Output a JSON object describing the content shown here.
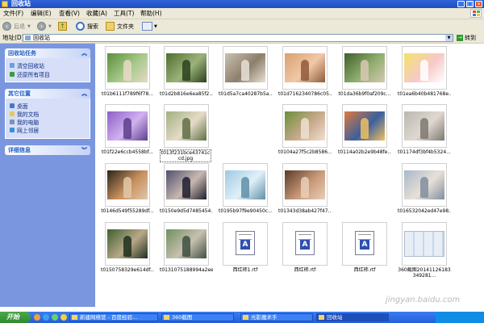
{
  "window": {
    "title": "回收站"
  },
  "menu": [
    "文件(F)",
    "编辑(E)",
    "查看(V)",
    "收藏(A)",
    "工具(T)",
    "帮助(H)"
  ],
  "toolbar": {
    "back": "后退",
    "search": "搜索",
    "folders": "文件夹"
  },
  "address": {
    "label": "地址(D)",
    "value": "回收站",
    "go": "转到"
  },
  "sidebar": {
    "tasks": {
      "title": "回收站任务",
      "items": [
        "清空回收站",
        "还原所有项目"
      ]
    },
    "places": {
      "title": "其它位置",
      "items": [
        "桌面",
        "我的文档",
        "我的电脑",
        "网上邻居"
      ]
    },
    "details": {
      "title": "详细信息"
    }
  },
  "files": [
    {
      "name": "t01b6111f789f6f78...",
      "art": "photo"
    },
    {
      "name": "t01d2b816e6ea85f2...",
      "art": "photo"
    },
    {
      "name": "t01d5a7ca40287b5a...",
      "art": "photo"
    },
    {
      "name": "t01d7162340786c05...",
      "art": "photo"
    },
    {
      "name": "t01da36b9f0af209c...",
      "art": "photo"
    },
    {
      "name": "t01ea6b40b481768e...",
      "art": "photo"
    },
    {
      "name": "t01f22e6ccb4558bf...",
      "art": "photo"
    },
    {
      "name": "t013f231bce43741ccd.jpg",
      "art": "photo"
    },
    {
      "name": "t0104a27f5c2b8586...",
      "art": "photo"
    },
    {
      "name": "t0114a02b2e9b48fe...",
      "art": "photo"
    },
    {
      "name": "t01174df3bf4b5324...",
      "art": "photo"
    },
    {
      "name": "t0146d549f55289df...",
      "art": "photo"
    },
    {
      "name": "t0150e9d5d7485454...",
      "art": "photo"
    },
    {
      "name": "t0195b97f9e90450c...",
      "art": "photo"
    },
    {
      "name": "t01343d38ab427f47...",
      "art": "photo"
    },
    {
      "name": "t016532042ed47e98...",
      "art": "photo"
    },
    {
      "name": "t0150758329e614df...",
      "art": "photo"
    },
    {
      "name": "t0131075188994a2ee...",
      "art": "photo"
    },
    {
      "name": "西红柿1.rtf",
      "art": "rtf"
    },
    {
      "name": "西红柿.rtf",
      "art": "rtf"
    },
    {
      "name": "西红柿.rtf",
      "art": "rtf"
    },
    {
      "name": "360截图20141126183349281...",
      "art": "screenshot"
    }
  ],
  "taskbar": {
    "start": "开始",
    "tasks": [
      "新建网络营 - 百度经验...",
      "360截图",
      "光影魔术手",
      "回收站"
    ]
  },
  "watermark": "jingyan.baidu.com",
  "colors": {
    "title": "#245edb",
    "sidebar": "#7a96df",
    "panel_text": "#215dc6",
    "taskbar": "#245edb"
  }
}
